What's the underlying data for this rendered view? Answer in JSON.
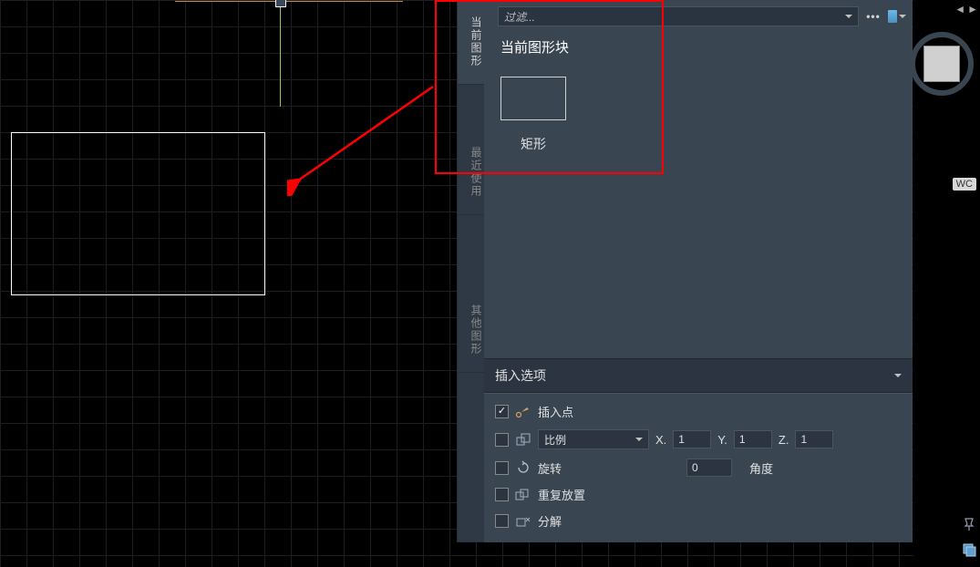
{
  "filter": {
    "placeholder": "过滤..."
  },
  "tabs": {
    "current": "当前图形",
    "recent": "最近使用",
    "other": "其他图形"
  },
  "section_title": "当前图形块",
  "blocks": [
    {
      "name": "矩形"
    }
  ],
  "insert_options": {
    "header": "插入选项",
    "insertion_point": "插入点",
    "scale": {
      "select_label": "比例",
      "x_label": "X.",
      "y_label": "Y.",
      "z_label": "Z.",
      "x": "1",
      "y": "1",
      "z": "1"
    },
    "rotate": {
      "label": "旋转",
      "value": "0",
      "unit": "角度"
    },
    "repeat": "重复放置",
    "explode": "分解"
  },
  "viewcube": {
    "wcs": "WC"
  }
}
